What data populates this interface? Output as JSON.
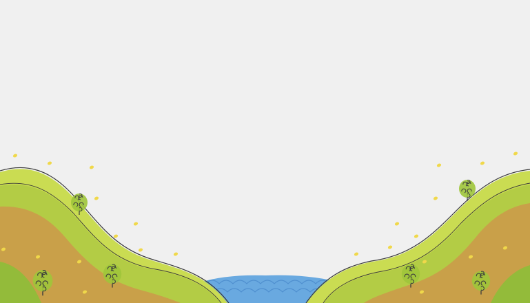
{
  "scene": {
    "background_color": "#f0f0f0",
    "colors": {
      "hill_light": "#cadc52",
      "hill_mid": "#b3cc45",
      "hill_dark": "#93bb3a",
      "soil": "#c9a049",
      "soil_light": "#d9b85a",
      "outline": "#3a3a3a",
      "water": "#69a9e0",
      "water_dark": "#4f8fcf",
      "petal": "#f0d84a",
      "tree_canopy": "#9fc53a",
      "tree_line": "#3d3d3d"
    },
    "elements": {
      "left_hill": "left-hill",
      "right_hill": "right-hill",
      "pond": "water-pond",
      "trees": [
        "tree",
        "tree",
        "tree",
        "tree",
        "tree",
        "tree"
      ],
      "petals": "falling-petals"
    }
  }
}
